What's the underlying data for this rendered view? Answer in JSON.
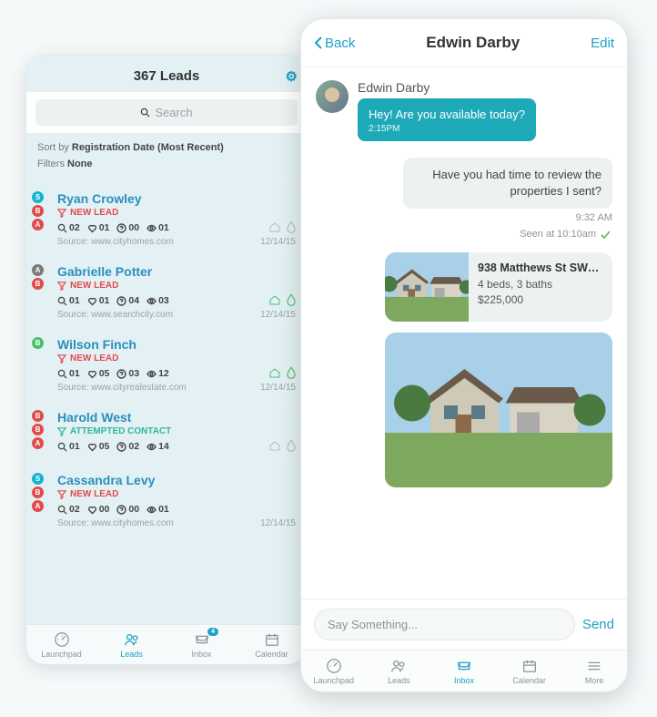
{
  "left": {
    "title": "367 Leads",
    "search_placeholder": "Search",
    "sort_label": "Sort by",
    "sort_value": "Registration Date (Most Recent)",
    "filters_label": "Filters",
    "filters_value": "None",
    "leads": [
      {
        "name": "Ryan Crowley",
        "status": "NEW LEAD",
        "status_type": "new",
        "m_search": "02",
        "m_fav": "01",
        "m_q": "00",
        "m_view": "01",
        "source": "Source: www.cityhomes.com",
        "date": "12/14/15"
      },
      {
        "name": "Gabrielle Potter",
        "status": "NEW LEAD",
        "status_type": "new",
        "m_search": "01",
        "m_fav": "01",
        "m_q": "04",
        "m_view": "03",
        "source": "Source: www.searchcity.com",
        "date": "12/14/15"
      },
      {
        "name": "Wilson Finch",
        "status": "NEW LEAD",
        "status_type": "new",
        "m_search": "01",
        "m_fav": "05",
        "m_q": "03",
        "m_view": "12",
        "source": "Source: www.cityrealestate.com",
        "date": "12/14/15"
      },
      {
        "name": "Harold West",
        "status": "ATTEMPTED CONTACT",
        "status_type": "att",
        "m_search": "01",
        "m_fav": "05",
        "m_q": "02",
        "m_view": "14",
        "source": "",
        "date": ""
      },
      {
        "name": "Cassandra Levy",
        "status": "NEW LEAD",
        "status_type": "new",
        "m_search": "02",
        "m_fav": "00",
        "m_q": "00",
        "m_view": "01",
        "source": "Source: www.cityhomes.com",
        "date": "12/14/15"
      }
    ],
    "tabs": {
      "launchpad": "Launchpad",
      "leads": "Leads",
      "inbox": "Inbox",
      "inbox_badge": "4",
      "calendar": "Calendar"
    }
  },
  "right": {
    "back": "Back",
    "title": "Edwin Darby",
    "edit": "Edit",
    "sender_name": "Edwin Darby",
    "msg1": "Hey! Are you available today?",
    "msg1_time": "2:15PM",
    "msg2": "Have you had time to review the properties I sent?",
    "msg2_time": "9:32 AM",
    "seen": "Seen at 10:10am",
    "listing": {
      "title": "938 Matthews St SW…",
      "specs": "4 beds, 3 baths",
      "price": "$225,000"
    },
    "input_placeholder": "Say Something...",
    "send": "Send",
    "tabs": {
      "launchpad": "Launchpad",
      "leads": "Leads",
      "inbox": "Inbox",
      "calendar": "Calendar",
      "more": "More"
    }
  }
}
